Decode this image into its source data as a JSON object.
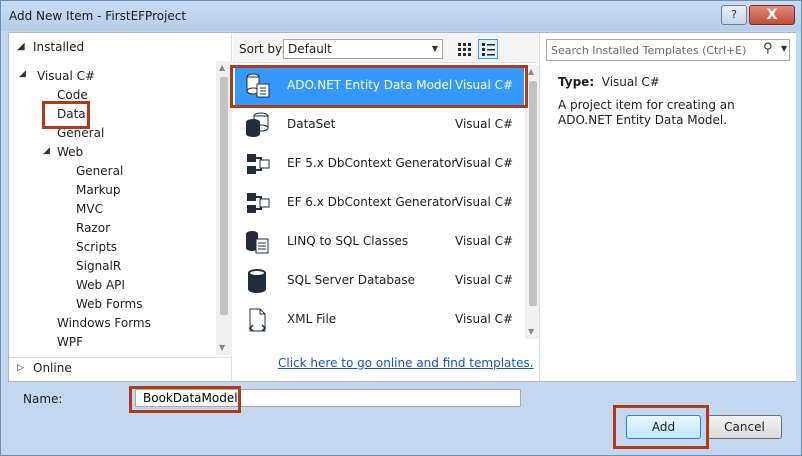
{
  "window": {
    "title": "Add New Item - FirstEFProject",
    "help_label": "?",
    "close_label": "X"
  },
  "sidebar": {
    "installed_label": "Installed",
    "online_label": "Online",
    "tree": [
      {
        "label": "Visual C#",
        "expanded": true
      },
      {
        "label": "Code"
      },
      {
        "label": "Data",
        "selected": true
      },
      {
        "label": "General"
      },
      {
        "label": "Web",
        "expanded": true
      },
      {
        "label": "General"
      },
      {
        "label": "Markup"
      },
      {
        "label": "MVC"
      },
      {
        "label": "Razor"
      },
      {
        "label": "Scripts"
      },
      {
        "label": "SignalR"
      },
      {
        "label": "Web API"
      },
      {
        "label": "Web Forms"
      },
      {
        "label": "Windows Forms"
      },
      {
        "label": "WPF"
      }
    ]
  },
  "toolbar": {
    "sort_label": "Sort by:",
    "sort_value": "Default"
  },
  "templates": [
    {
      "name": "ADO.NET Entity Data Model",
      "type": "Visual C#",
      "icon": "entity-model-icon",
      "selected": true
    },
    {
      "name": "DataSet",
      "type": "Visual C#",
      "icon": "dataset-icon"
    },
    {
      "name": "EF 5.x DbContext Generator",
      "type": "Visual C#",
      "icon": "dbcontext-generator-icon"
    },
    {
      "name": "EF 6.x DbContext Generator",
      "type": "Visual C#",
      "icon": "dbcontext-generator-icon"
    },
    {
      "name": "LINQ to SQL Classes",
      "type": "Visual C#",
      "icon": "linq-to-sql-icon"
    },
    {
      "name": "SQL Server Database",
      "type": "Visual C#",
      "icon": "database-icon"
    },
    {
      "name": "XML File",
      "type": "Visual C#",
      "icon": "xml-file-icon"
    }
  ],
  "online_link": "Click here to go online and find templates.",
  "search": {
    "placeholder": "Search Installed Templates (Ctrl+E)"
  },
  "details": {
    "type_label": "Type:",
    "type_value": "Visual C#",
    "description": "A project item for creating an ADO.NET Entity Data Model."
  },
  "name_field": {
    "label": "Name:",
    "value": "BookDataModel"
  },
  "buttons": {
    "add": "Add",
    "cancel": "Cancel"
  },
  "colors": {
    "selection": "#3399ff",
    "highlight": "#b23a1c",
    "link": "#1a4fcf"
  }
}
